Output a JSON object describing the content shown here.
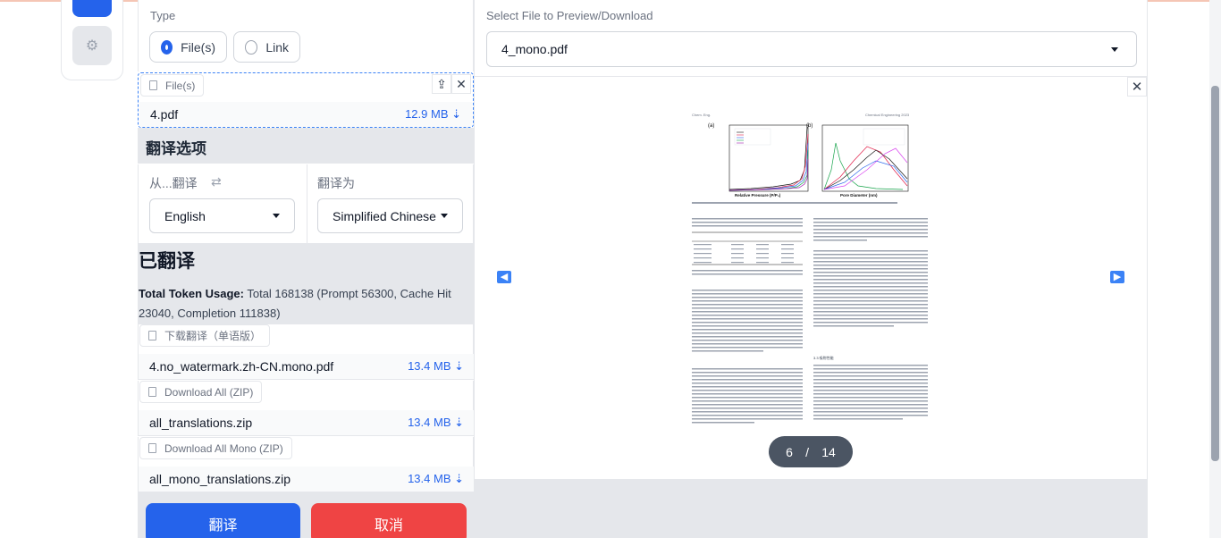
{
  "type_section": {
    "label": "Type",
    "options": [
      "File(s)",
      "Link"
    ],
    "selected": "File(s)"
  },
  "upload": {
    "chip_label": "File(s)",
    "file_name": "4.pdf",
    "file_size": "12.9 MB ⇣"
  },
  "options_section": {
    "title": "翻译选项",
    "from_label": "从...翻译",
    "swap_icon": "⇄",
    "to_label": "翻译为",
    "from_value": "English",
    "to_value": "Simplified Chinese"
  },
  "translated_section": {
    "title": "已翻译",
    "usage_label": "Total Token Usage:",
    "usage_text": " Total 168138 (Prompt 56300, Cache Hit 23040, Completion 111838)"
  },
  "downloads": [
    {
      "chip": "下载翻译（单语版）",
      "file": "4.no_watermark.zh-CN.mono.pdf",
      "size": "13.4 MB ⇣"
    },
    {
      "chip": "Download All (ZIP)",
      "file": "all_translations.zip",
      "size": "13.4 MB ⇣"
    },
    {
      "chip": "Download All Mono (ZIP)",
      "file": "all_mono_translations.zip",
      "size": "13.4 MB ⇣"
    }
  ],
  "actions": {
    "translate": "翻译",
    "cancel": "取消"
  },
  "preview": {
    "label": "Select File to Preview/Download",
    "selected_file": "4_mono.pdf",
    "current_page": "6",
    "page_sep": "/",
    "total_pages": "14",
    "page_header_left": "Chem. Eng.",
    "page_header_right": "Chemical Engineering 2023",
    "panel_a": "(a)",
    "panel_b": "(b)",
    "xlabel_a": "Relative Pressure (P/P₀)",
    "xlabel_b": "Pore Diameter (nm)",
    "section_heading": "3.3 吸附性能"
  },
  "colors": {
    "accent": "#2563eb",
    "danger": "#ef4444",
    "pager": "#4b5563"
  }
}
